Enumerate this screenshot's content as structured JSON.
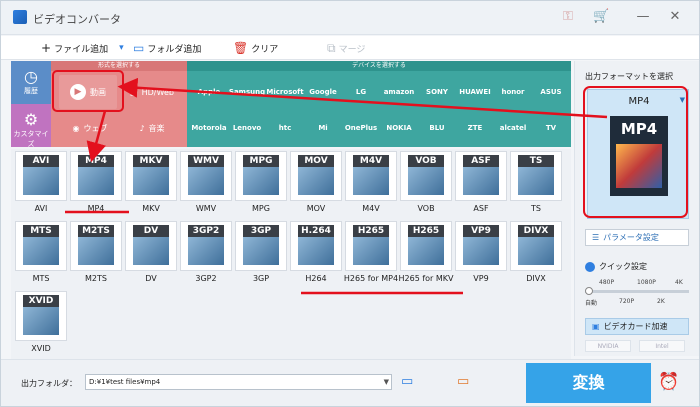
{
  "window": {
    "title": "ビデオコンバータ"
  },
  "toolbar": {
    "add_file": "ファイル追加",
    "add_folder": "フォルダ追加",
    "clear": "クリア",
    "merge": "マージ"
  },
  "categories": {
    "recent": "履歴",
    "custom": "カスタマイズ",
    "format_header": "形式を選択する",
    "device_header": "デバイスを選択する",
    "video": "動画",
    "hd": "HD/Web",
    "web": "ウェブ",
    "audio": "音楽"
  },
  "brands": [
    "Apple",
    "Samsung",
    "Microsoft",
    "Google",
    "LG",
    "amazon",
    "SONY",
    "HUAWEI",
    "honor",
    "ASUS",
    "Motorola",
    "Lenovo",
    "htc",
    "Mi",
    "OnePlus",
    "NOKIA",
    "BLU",
    "ZTE",
    "alcatel",
    "TV"
  ],
  "formats": [
    {
      "badge": "AVI",
      "label": "AVI"
    },
    {
      "badge": "MP4",
      "label": "MP4"
    },
    {
      "badge": "MKV",
      "label": "MKV"
    },
    {
      "badge": "WMV",
      "label": "WMV"
    },
    {
      "badge": "MPG",
      "label": "MPG"
    },
    {
      "badge": "MOV",
      "label": "MOV"
    },
    {
      "badge": "M4V",
      "label": "M4V"
    },
    {
      "badge": "VOB",
      "label": "VOB"
    },
    {
      "badge": "ASF",
      "label": "ASF"
    },
    {
      "badge": "TS",
      "label": "TS"
    },
    {
      "badge": "MTS",
      "label": "MTS"
    },
    {
      "badge": "M2TS",
      "label": "M2TS"
    },
    {
      "badge": "DV",
      "label": "DV"
    },
    {
      "badge": "3GP2",
      "label": "3GP2"
    },
    {
      "badge": "3GP",
      "label": "3GP"
    },
    {
      "badge": "H.264",
      "label": "H264"
    },
    {
      "badge": "H265",
      "label": "H265 for MP4"
    },
    {
      "badge": "H265",
      "label": "H265 for MKV"
    },
    {
      "badge": "VP9",
      "label": "VP9"
    },
    {
      "badge": "DIVX",
      "label": "DIVX"
    },
    {
      "badge": "XVID",
      "label": "XVID"
    }
  ],
  "right": {
    "title": "出力フォーマットを選択",
    "selected": "MP4",
    "big_badge": "MP4",
    "params": "パラメータ設定",
    "quick": "クイック設定",
    "q480": "480P",
    "q1080": "1080P",
    "q4k": "4K",
    "qauto": "自動",
    "q720": "720P",
    "q2k": "2K",
    "gpu": "ビデオカード加速",
    "nvidia": "NVIDIA",
    "intel": "Intel"
  },
  "bottom": {
    "out_label": "出力フォルダ：",
    "out_path": "D:¥1¥test files¥mp4",
    "convert": "変換"
  },
  "colors": {
    "annotation": "#e3101d",
    "accent": "#35a3e8"
  }
}
